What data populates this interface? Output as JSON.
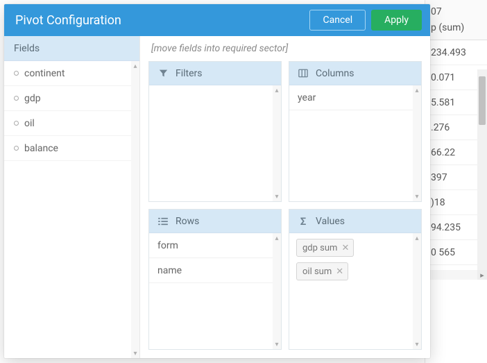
{
  "header": {
    "title": "Pivot Configuration",
    "cancel_label": "Cancel",
    "apply_label": "Apply"
  },
  "hint": "[move fields into required sector]",
  "fields_title": "Fields",
  "fields": [
    {
      "label": "continent"
    },
    {
      "label": "gdp"
    },
    {
      "label": "oil"
    },
    {
      "label": "balance"
    }
  ],
  "sectors": {
    "filters": {
      "title": "Filters",
      "items": []
    },
    "columns": {
      "title": "Columns",
      "items": [
        {
          "label": "year"
        }
      ]
    },
    "rows": {
      "title": "Rows",
      "items": [
        {
          "label": "form"
        },
        {
          "label": "name"
        }
      ]
    },
    "values": {
      "title": "Values",
      "items": [
        {
          "field": "gdp",
          "op": "sum"
        },
        {
          "field": "oil",
          "op": "sum"
        }
      ]
    }
  },
  "background_table": {
    "header_cells": [
      "07",
      "p (sum)"
    ],
    "rows": [
      "234.493",
      "0.071",
      "5.581",
      ".276",
      "66.22",
      "397",
      ")18",
      "94.235",
      "0 565"
    ]
  }
}
